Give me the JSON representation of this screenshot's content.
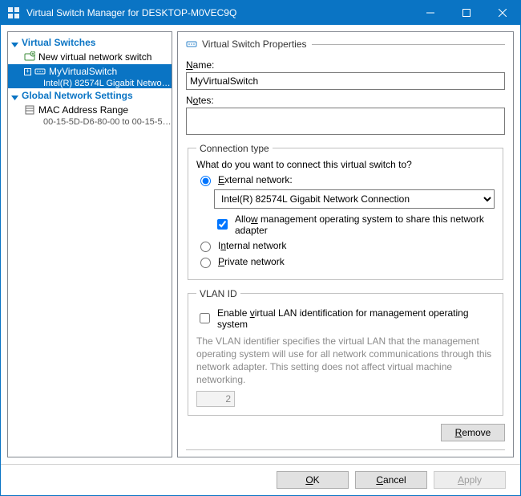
{
  "window": {
    "title": "Virtual Switch Manager for DESKTOP-M0VEC9Q"
  },
  "tree": {
    "section1": "Virtual Switches",
    "new_switch": "New virtual network switch",
    "my_switch": "MyVirtualSwitch",
    "my_switch_sub": "Intel(R) 82574L Gigabit Network C...",
    "section2": "Global Network Settings",
    "mac_range": "MAC Address Range",
    "mac_range_sub": "00-15-5D-D6-80-00 to 00-15-5D-D..."
  },
  "props": {
    "header": "Virtual Switch Properties",
    "name_label": "Name:",
    "name_value": "MyVirtualSwitch",
    "notes_label": "Notes:",
    "notes_value": "",
    "conn": {
      "legend": "Connection type",
      "question": "What do you want to connect this virtual switch to?",
      "external_label": "External network:",
      "adapter_value": "Intel(R) 82574L Gigabit Network Connection",
      "allow_mgmt": "Allow management operating system to share this network adapter",
      "internal_label": "Internal network",
      "private_label": "Private network"
    },
    "vlan": {
      "legend": "VLAN ID",
      "enable": "Enable virtual LAN identification for management operating system",
      "help": "The VLAN identifier specifies the virtual LAN that the management operating system will use for all network communications through this network adapter. This setting does not affect virtual machine networking.",
      "value": "2"
    },
    "remove": "Remove"
  },
  "footer": {
    "ok": "OK",
    "cancel": "Cancel",
    "apply": "Apply"
  }
}
